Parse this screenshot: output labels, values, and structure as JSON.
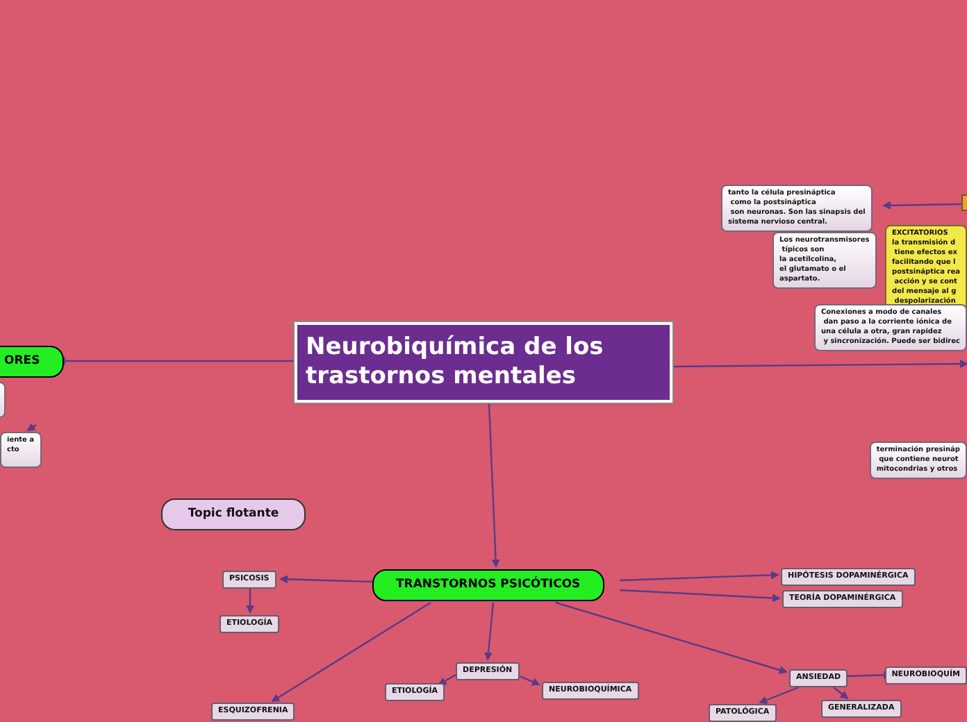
{
  "map": {
    "nodes": [
      {
        "kind": "stub"
      },
      {
        "kind": "note",
        "text": "tanto la célula presináptica\n como la postsináptica\n son neuronas. Son las sinapsis del\nsistema nervioso central."
      },
      {
        "kind": "note",
        "text": "Los neurotransmisores\n típicos son\nla acetilcolina,\nel glutamato o el\naspartato."
      },
      {
        "kind": "highlight",
        "text": "EXCITATORIOS\nla transmisión d\n tiene efectos ex\nfacilitando que l\npostsináptica rea\n acción y se cont\ndel mensaje al g\n despolarización"
      },
      {
        "kind": "note",
        "text": "Conexiones a modo de canales\n dan paso a la corriente iónica de\nuna célula a otra, gran rapidez\n y sincronización. Puede ser bidirec"
      },
      {
        "kind": "main",
        "text": "ORES"
      },
      {
        "kind": "central",
        "text": "Neurobiquímica de los trastornos mentales"
      },
      {
        "kind": "note"
      },
      {
        "kind": "note",
        "text": "iente a\ncto"
      },
      {
        "kind": "note",
        "text": "terminación presináp\n que contiene neurot\nmitocondrias y otros"
      },
      {
        "kind": "floating",
        "text": "Topic flotante"
      },
      {
        "kind": "subtopic",
        "text": "PSICOSIS"
      },
      {
        "kind": "main",
        "text": "TRANSTORNOS PSICÓTICOS"
      },
      {
        "kind": "subtopic",
        "text": "HIPÓTESIS DOPAMINÉRGICA"
      },
      {
        "kind": "subtopic",
        "text": "TEORÍA DOPAMINÉRGICA"
      },
      {
        "kind": "subtopic",
        "text": "ETIOLOGÍA"
      },
      {
        "kind": "subtopic",
        "text": "DEPRESIÓN"
      },
      {
        "kind": "subtopic",
        "text": "ANSIEDAD"
      },
      {
        "kind": "subtopic",
        "text": "NEUROBIOQUÍM"
      },
      {
        "kind": "subtopic",
        "text": "ETIOLOGÍA"
      },
      {
        "kind": "subtopic",
        "text": "NEUROBIOQUÍMICA"
      },
      {
        "kind": "subtopic",
        "text": "ESQUIZOFRENIA"
      },
      {
        "kind": "subtopic",
        "text": "PATOLÓGICA"
      },
      {
        "kind": "subtopic",
        "text": "GENERALIZADA"
      }
    ]
  }
}
